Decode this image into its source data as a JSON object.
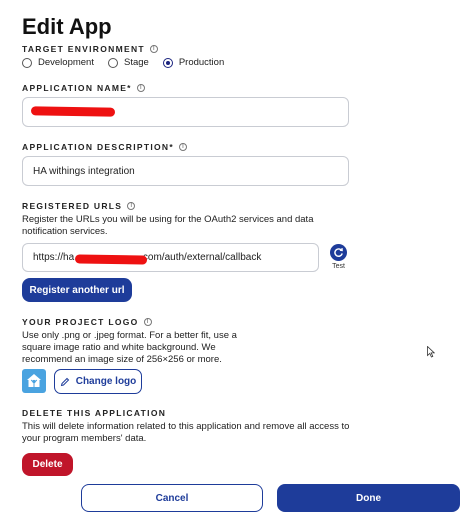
{
  "header": {
    "title": "Edit App"
  },
  "environment": {
    "label": "TARGET ENVIRONMENT",
    "options": [
      {
        "label": "Development",
        "checked": false
      },
      {
        "label": "Stage",
        "checked": false
      },
      {
        "label": "Production",
        "checked": true
      }
    ]
  },
  "app_name": {
    "label": "APPLICATION NAME*",
    "value": ""
  },
  "app_description": {
    "label": "APPLICATION DESCRIPTION*",
    "value": "HA withings integration"
  },
  "registered_urls": {
    "label": "REGISTERED URLS",
    "description": "Register the URLs you will be using for the OAuth2 services and data notification services.",
    "url_prefix": "https://ha",
    "url_suffix": ".com/auth/external/callback",
    "test_label": "Test",
    "register_button": "Register another url"
  },
  "project_logo": {
    "label": "YOUR PROJECT LOGO",
    "description": "Use only .png or .jpeg format. For a better fit, use a square image ratio and white background. We recommend an image size of 256×256 or more.",
    "change_button": "Change logo"
  },
  "delete_section": {
    "label": "DELETE THIS APPLICATION",
    "description": "This will delete information related to this application and remove all access to your program members' data.",
    "delete_button": "Delete"
  },
  "footer": {
    "cancel_button": "Cancel",
    "done_button": "Done"
  },
  "colors": {
    "primary": "#1e3c9a",
    "danger": "#c0152a",
    "redaction": "#ee1111"
  }
}
